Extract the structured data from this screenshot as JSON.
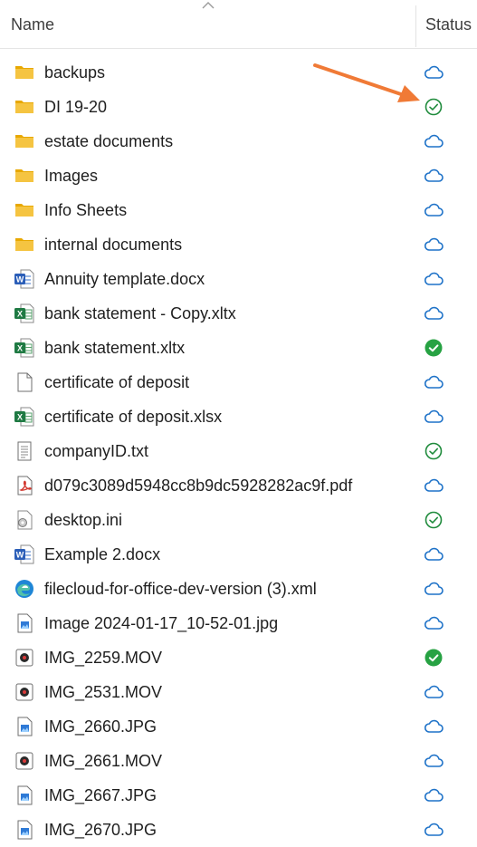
{
  "header": {
    "name_label": "Name",
    "status_label": "Status"
  },
  "rows": [
    {
      "name": "backups",
      "type": "folder",
      "status": "cloud"
    },
    {
      "name": "DI 19-20",
      "type": "folder",
      "status": "available"
    },
    {
      "name": "estate documents",
      "type": "folder",
      "status": "cloud"
    },
    {
      "name": "Images",
      "type": "folder",
      "status": "cloud"
    },
    {
      "name": "Info Sheets",
      "type": "folder",
      "status": "cloud"
    },
    {
      "name": "internal documents",
      "type": "folder",
      "status": "cloud"
    },
    {
      "name": "Annuity template.docx",
      "type": "word",
      "status": "cloud"
    },
    {
      "name": "bank statement - Copy.xltx",
      "type": "excel",
      "status": "cloud"
    },
    {
      "name": "bank statement.xltx",
      "type": "excel",
      "status": "always-available"
    },
    {
      "name": "certificate of deposit",
      "type": "blank",
      "status": "cloud"
    },
    {
      "name": "certificate of deposit.xlsx",
      "type": "excel",
      "status": "cloud"
    },
    {
      "name": "companyID.txt",
      "type": "text",
      "status": "available"
    },
    {
      "name": "d079c3089d5948cc8b9dc5928282ac9f.pdf",
      "type": "pdf",
      "status": "cloud"
    },
    {
      "name": "desktop.ini",
      "type": "settings",
      "status": "available"
    },
    {
      "name": "Example 2.docx",
      "type": "word",
      "status": "cloud"
    },
    {
      "name": "filecloud-for-office-dev-version (3).xml",
      "type": "edge",
      "status": "cloud"
    },
    {
      "name": "Image 2024-01-17_10-52-01.jpg",
      "type": "image",
      "status": "cloud"
    },
    {
      "name": "IMG_2259.MOV",
      "type": "video",
      "status": "always-available"
    },
    {
      "name": "IMG_2531.MOV",
      "type": "video",
      "status": "cloud"
    },
    {
      "name": "IMG_2660.JPG",
      "type": "image",
      "status": "cloud"
    },
    {
      "name": "IMG_2661.MOV",
      "type": "video",
      "status": "cloud"
    },
    {
      "name": "IMG_2667.JPG",
      "type": "image",
      "status": "cloud"
    },
    {
      "name": "IMG_2670.JPG",
      "type": "image",
      "status": "cloud"
    }
  ],
  "colors": {
    "folder": "#f5c441",
    "cloud": "#1e72c8",
    "available": "#1f8b3c",
    "always_available": "#27a243",
    "arrow": "#f07a36",
    "word": "#2b5eb8",
    "excel": "#1f7a43",
    "pdf": "#d2382f"
  },
  "icons": {
    "folder": "folder-icon",
    "word": "word-document-icon",
    "excel": "excel-spreadsheet-icon",
    "blank": "blank-file-icon",
    "text": "text-file-icon",
    "pdf": "pdf-file-icon",
    "settings": "settings-file-icon",
    "edge": "edge-browser-icon",
    "image": "image-file-icon",
    "video": "video-file-icon",
    "cloud": "cloud-status-icon",
    "available": "available-offline-icon",
    "always-available": "always-available-icon"
  }
}
